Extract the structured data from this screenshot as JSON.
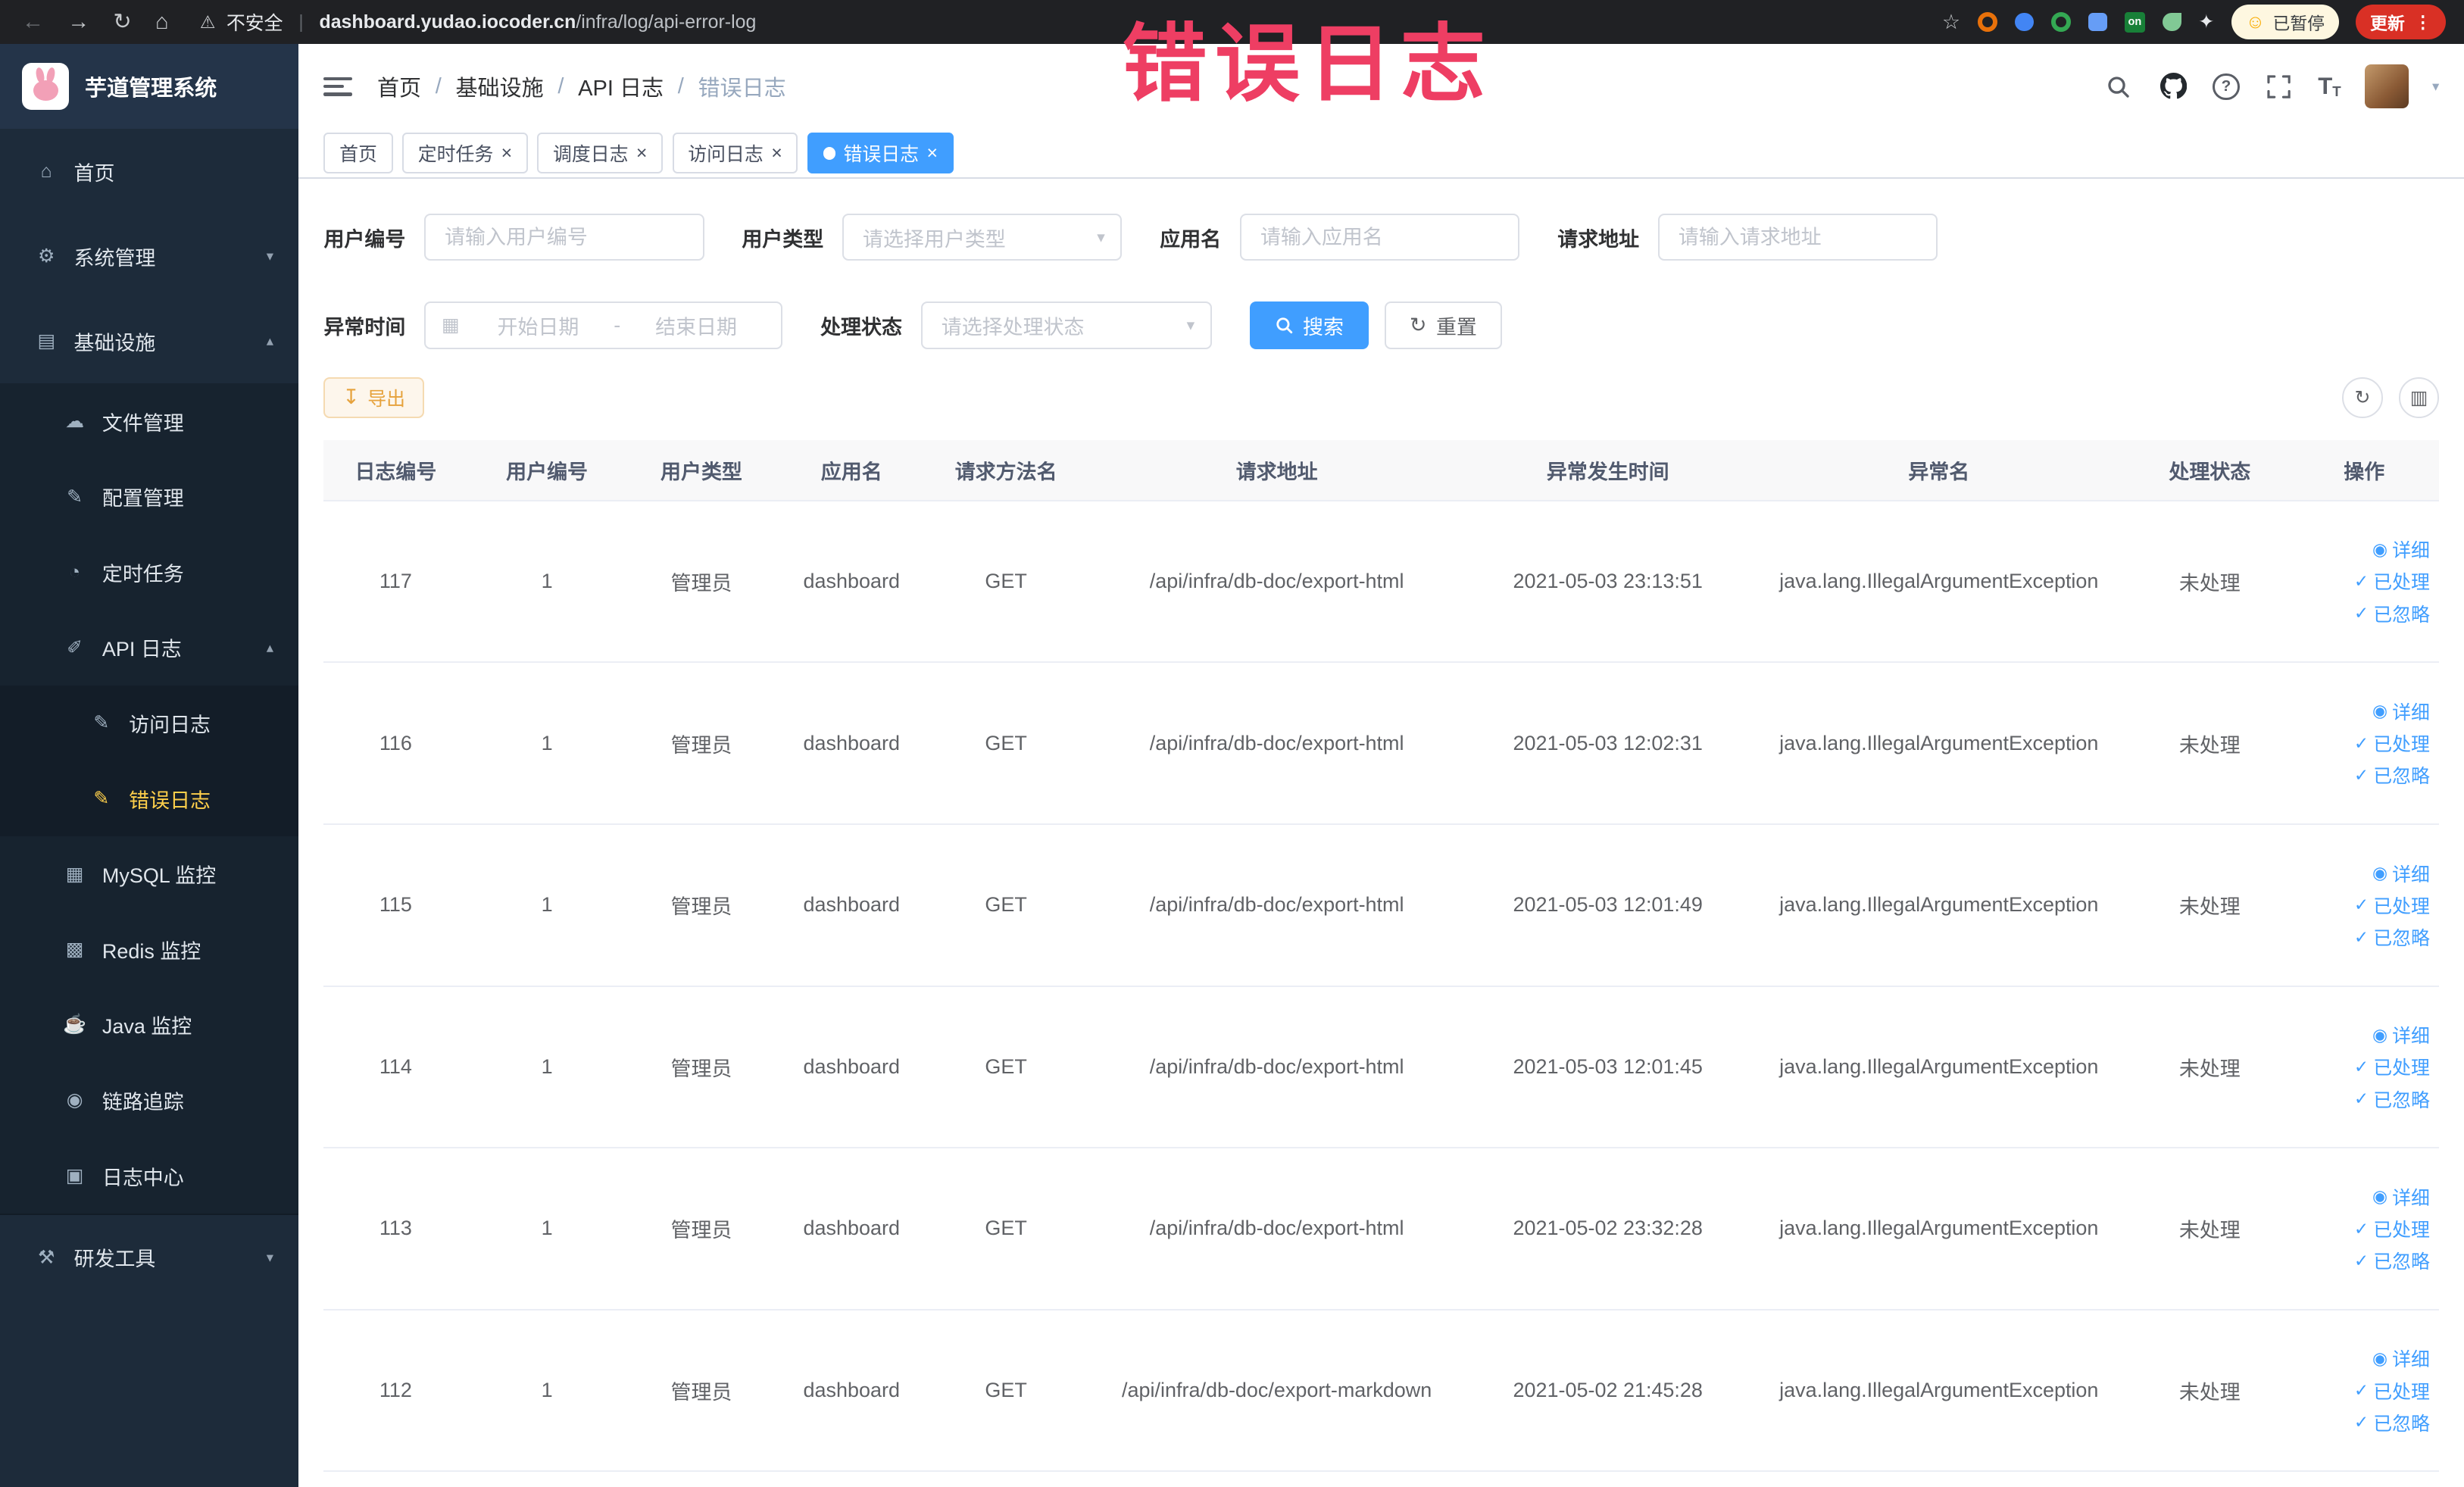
{
  "browser": {
    "security_label": "不安全",
    "url_domain": "dashboard.yudao.iocoder.cn",
    "url_path": "/infra/log/api-error-log",
    "ext_on": "on",
    "paused_badge": "已暂停",
    "update_button": "更新"
  },
  "watermark": "错误日志",
  "sidebar": {
    "title": "芋道管理系统",
    "items": [
      {
        "label": "首页"
      },
      {
        "label": "系统管理"
      },
      {
        "label": "基础设施"
      },
      {
        "label": "文件管理"
      },
      {
        "label": "配置管理"
      },
      {
        "label": "定时任务"
      },
      {
        "label": "API 日志"
      },
      {
        "label": "访问日志"
      },
      {
        "label": "错误日志"
      },
      {
        "label": "MySQL 监控"
      },
      {
        "label": "Redis 监控"
      },
      {
        "label": "Java 监控"
      },
      {
        "label": "链路追踪"
      },
      {
        "label": "日志中心"
      },
      {
        "label": "研发工具"
      }
    ]
  },
  "breadcrumb": {
    "separator": "/",
    "items": [
      "首页",
      "基础设施",
      "API 日志",
      "错误日志"
    ]
  },
  "tabs": [
    {
      "label": "首页"
    },
    {
      "label": "定时任务"
    },
    {
      "label": "调度日志"
    },
    {
      "label": "访问日志"
    },
    {
      "label": "错误日志"
    }
  ],
  "filters": {
    "user_id": {
      "label": "用户编号",
      "placeholder": "请输入用户编号"
    },
    "user_type": {
      "label": "用户类型",
      "placeholder": "请选择用户类型"
    },
    "app_name": {
      "label": "应用名",
      "placeholder": "请输入应用名"
    },
    "request_url": {
      "label": "请求地址",
      "placeholder": "请输入请求地址"
    },
    "exception_time": {
      "label": "异常时间",
      "start_placeholder": "开始日期",
      "separator": "-",
      "end_placeholder": "结束日期"
    },
    "process_status": {
      "label": "处理状态",
      "placeholder": "请选择处理状态"
    },
    "search_button": "搜索",
    "reset_button": "重置"
  },
  "toolbar": {
    "export_label": "导出"
  },
  "table": {
    "columns": [
      "日志编号",
      "用户编号",
      "用户类型",
      "应用名",
      "请求方法名",
      "请求地址",
      "异常发生时间",
      "异常名",
      "处理状态",
      "操作"
    ],
    "actions": {
      "detail": "详细",
      "processed": "已处理",
      "ignored": "已忽略"
    },
    "rows": [
      {
        "cells": [
          "117",
          "1",
          "管理员",
          "dashboard",
          "GET",
          "/api/infra/db-doc/export-html",
          "2021-05-03 23:13:51",
          "java.lang.IllegalArgumentException",
          "未处理"
        ]
      },
      {
        "cells": [
          "116",
          "1",
          "管理员",
          "dashboard",
          "GET",
          "/api/infra/db-doc/export-html",
          "2021-05-03 12:02:31",
          "java.lang.IllegalArgumentException",
          "未处理"
        ]
      },
      {
        "cells": [
          "115",
          "1",
          "管理员",
          "dashboard",
          "GET",
          "/api/infra/db-doc/export-html",
          "2021-05-03 12:01:49",
          "java.lang.IllegalArgumentException",
          "未处理"
        ]
      },
      {
        "cells": [
          "114",
          "1",
          "管理员",
          "dashboard",
          "GET",
          "/api/infra/db-doc/export-html",
          "2021-05-03 12:01:45",
          "java.lang.IllegalArgumentException",
          "未处理"
        ]
      },
      {
        "cells": [
          "113",
          "1",
          "管理员",
          "dashboard",
          "GET",
          "/api/infra/db-doc/export-html",
          "2021-05-02 23:32:28",
          "java.lang.IllegalArgumentException",
          "未处理"
        ]
      },
      {
        "cells": [
          "112",
          "1",
          "管理员",
          "dashboard",
          "GET",
          "/api/infra/db-doc/export-markdown",
          "2021-05-02 21:45:28",
          "java.lang.IllegalArgumentException",
          "未处理"
        ]
      }
    ]
  },
  "icons": {
    "back": "←",
    "forward": "→",
    "reload": "↻",
    "home_nav": "⌂",
    "warning": "⚠",
    "pipe": "|",
    "star": "☆",
    "pinwheel": "✦",
    "smiley": "☺",
    "menu_dots": "⋮",
    "home": "⌂",
    "system": "⚙",
    "infra": "▤",
    "file": "☁",
    "config": "✎",
    "job": "◔",
    "apilog": "✐",
    "accesslog": "✎",
    "errorlog": "✎",
    "mysql": "▦",
    "redis": "▩",
    "java": "☕",
    "trace": "◉",
    "logcenter": "▣",
    "devtools": "⚒",
    "chevron_down": "▾",
    "chevron_up": "▴",
    "caret_down": "▾",
    "calendar": "▦",
    "refresh": "↻",
    "grid": "▥",
    "download": "↧",
    "eye": "◉",
    "check": "✓",
    "close": "×",
    "question": "?",
    "font_size": "T"
  }
}
